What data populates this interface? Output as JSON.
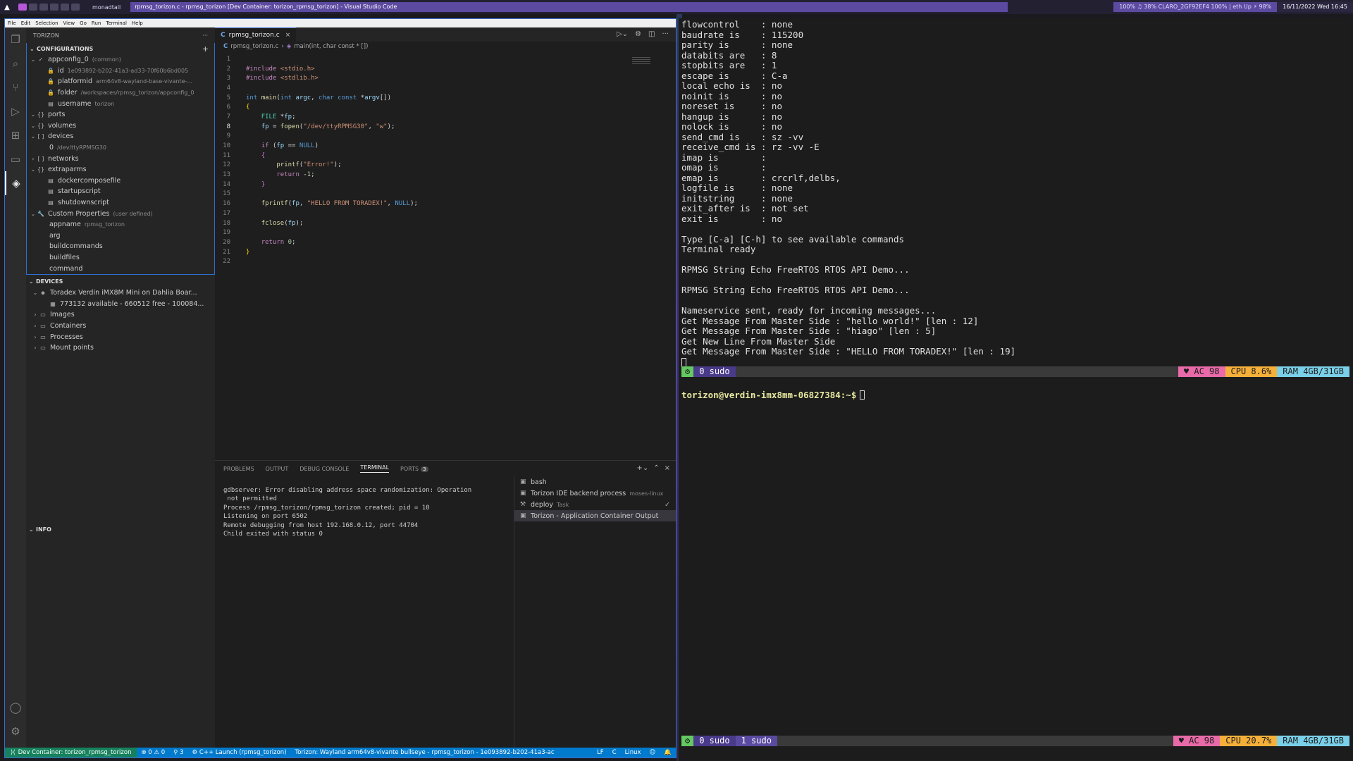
{
  "topbar": {
    "layout": "monadtall",
    "window_title": "rpmsg_torizon.c - rpmsg_torizon [Dev Container: torizon_rpmsg_torizon] - Visual Studio Code",
    "sysinfo": "100%   ♫ 38% CLARO_2GF92EF4 100%  | eth Up  ⚡ 98%",
    "clock": "16/11/2022 Wed 16:45"
  },
  "menubar": [
    "File",
    "Edit",
    "Selection",
    "View",
    "Go",
    "Run",
    "Terminal",
    "Help"
  ],
  "sidebar": {
    "title": "TORIZON",
    "configurations_title": "CONFIGURATIONS",
    "config_rows": [
      {
        "label": "appconfig_0",
        "desc": "(common)"
      },
      {
        "label": "id",
        "desc": "1e093892-b202-41a3-ad33-70f60b6bd005"
      },
      {
        "label": "platformid",
        "desc": "arm64v8-wayland-base-vivante-..."
      },
      {
        "label": "folder",
        "desc": "/workspaces/rpmsg_torizon/appconfig_0"
      },
      {
        "label": "username",
        "desc": "torizon"
      },
      {
        "label": "ports",
        "desc": ""
      },
      {
        "label": "volumes",
        "desc": ""
      },
      {
        "label": "devices",
        "desc": ""
      },
      {
        "label": "0",
        "desc": "/dev/ttyRPMSG30"
      },
      {
        "label": "networks",
        "desc": ""
      },
      {
        "label": "extraparms",
        "desc": ""
      },
      {
        "label": "dockercomposefile",
        "desc": ""
      },
      {
        "label": "startupscript",
        "desc": ""
      },
      {
        "label": "shutdownscript",
        "desc": ""
      },
      {
        "label": "Custom Properties",
        "desc": "(user defined)"
      },
      {
        "label": "appname",
        "desc": "rpmsg_torizon"
      },
      {
        "label": "arg",
        "desc": ""
      },
      {
        "label": "buildcommands",
        "desc": ""
      },
      {
        "label": "buildfiles",
        "desc": ""
      },
      {
        "label": "command",
        "desc": ""
      }
    ],
    "devices_title": "DEVICES",
    "device_rows": [
      {
        "label": "Toradex Verdin iMX8M Mini on Dahlia Boar..."
      },
      {
        "label": "773132 available - 660512 free - 100084..."
      },
      {
        "label": "Images"
      },
      {
        "label": "Containers"
      },
      {
        "label": "Processes"
      },
      {
        "label": "Mount points"
      }
    ],
    "info_title": "INFO"
  },
  "editor": {
    "tab_label": "rpmsg_torizon.c",
    "breadcrumb_file": "rpmsg_torizon.c",
    "breadcrumb_symbol": "main(int, char const * [])",
    "current_line": "8"
  },
  "panel": {
    "tabs": [
      "PROBLEMS",
      "OUTPUT",
      "DEBUG CONSOLE",
      "TERMINAL",
      "PORTS"
    ],
    "ports_count": "3",
    "output_lines": [
      "gdbserver: Error disabling address space randomization: Operation",
      " not permitted",
      "Process /rpmsg_torizon/rpmsg_torizon created; pid = 10",
      "Listening on port 6502",
      "Remote debugging from host 192.168.0.12, port 44704",
      "Child exited with status 0"
    ],
    "terminals": [
      {
        "label": "bash",
        "desc": ""
      },
      {
        "label": "Torizon IDE backend process",
        "desc": "moses-linux"
      },
      {
        "label": "deploy",
        "desc": "Task"
      },
      {
        "label": "Torizon - Application Container Output",
        "desc": ""
      }
    ]
  },
  "statusbar": {
    "remote": "Dev Container: torizon_rpmsg_torizon",
    "problems": "⊗ 0 ⚠ 0",
    "ports": "⚲ 3",
    "launch": "C++ Launch (rpmsg_torizon)",
    "torizon": "Torizon: Wayland arm64v8-vivante bullseye - rpmsg_torizon - 1e093892-b202-41a3-ac",
    "eol": "LF",
    "lang": "C",
    "platform": "Linux"
  },
  "right_terminal": {
    "lines": [
      "flowcontrol    : none",
      "baudrate is    : 115200",
      "parity is      : none",
      "databits are   : 8",
      "stopbits are   : 1",
      "escape is      : C-a",
      "local echo is  : no",
      "noinit is      : no",
      "noreset is     : no",
      "hangup is      : no",
      "nolock is      : no",
      "send_cmd is    : sz -vv",
      "receive_cmd is : rz -vv -E",
      "imap is        :",
      "omap is        :",
      "emap is        : crcrlf,delbs,",
      "logfile is     : none",
      "initstring     : none",
      "exit_after is  : not set",
      "exit is        : no",
      "",
      "Type [C-a] [C-h] to see available commands",
      "Terminal ready",
      "",
      "RPMSG String Echo FreeRTOS RTOS API Demo...",
      "",
      "RPMSG String Echo FreeRTOS RTOS API Demo...",
      "",
      "Nameservice sent, ready for incoming messages...",
      "Get Message From Master Side : \"hello world!\" [len : 12]",
      "Get Message From Master Side : \"hiago\" [len : 5]",
      "Get New Line From Master Side",
      "Get Message From Master Side : \"HELLO FROM TORADEX!\" [len : 19]"
    ],
    "prompt": "torizon@verdin-imx8mm-06827384:~$",
    "bar1": {
      "win": "0 sudo",
      "ac": "♥ AC  98",
      "cpu": "CPU  8.6%",
      "ram": "RAM 4GB/31GB"
    },
    "bar2": {
      "win0": "0 sudo",
      "win1": "1 sudo",
      "ac": "♥ AC  98",
      "cpu": "CPU 20.7%",
      "ram": "RAM 4GB/31GB"
    }
  }
}
